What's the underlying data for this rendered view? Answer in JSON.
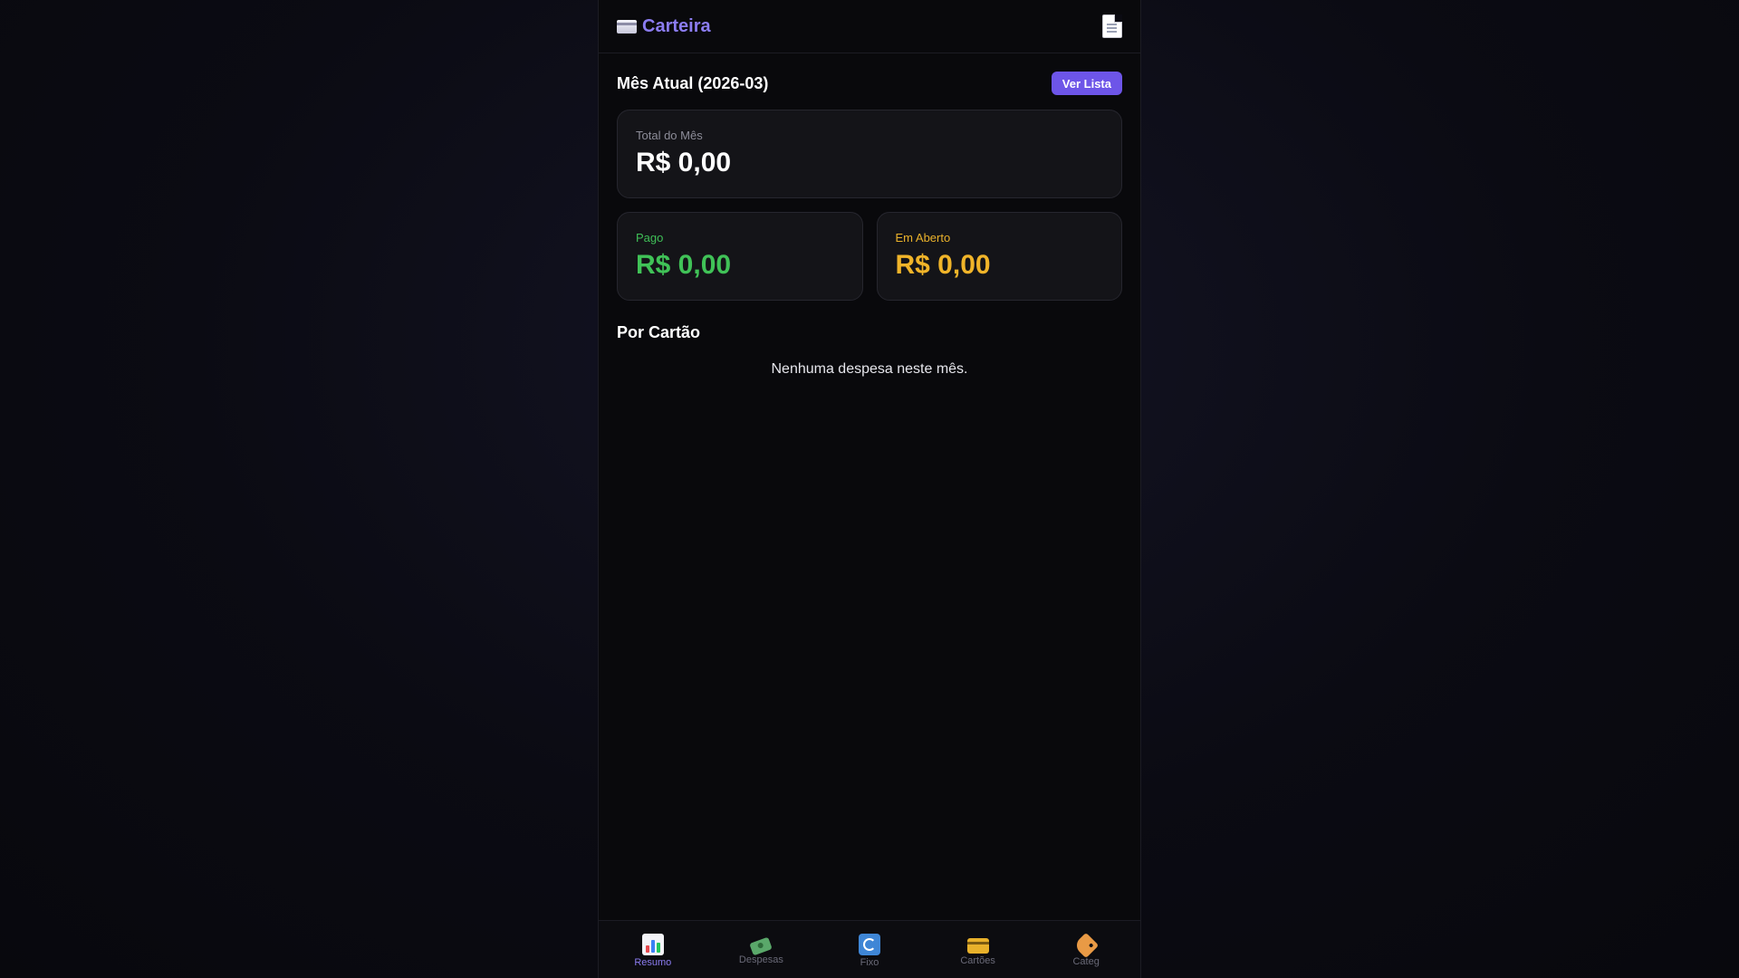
{
  "header": {
    "title": "Carteira",
    "brand_icon": "card-icon",
    "action_icon": "document-icon"
  },
  "summary": {
    "month_title": "Mês Atual (2026-03)",
    "view_list_label": "Ver Lista",
    "total": {
      "label": "Total do Mês",
      "value": "R$ 0,00"
    },
    "paid": {
      "label": "Pago",
      "value": "R$ 0,00",
      "color": "#40c257"
    },
    "open": {
      "label": "Em Aberto",
      "value": "R$ 0,00",
      "color": "#f0b429"
    }
  },
  "by_card": {
    "title": "Por Cartão",
    "empty_message": "Nenhuma despesa neste mês."
  },
  "nav": {
    "active": "Resumo",
    "accent": "#8b7cf0",
    "items": [
      {
        "label": "Resumo",
        "icon": "bar-chart-icon"
      },
      {
        "label": "Despesas",
        "icon": "money-wings-icon"
      },
      {
        "label": "Fixo",
        "icon": "repeat-icon"
      },
      {
        "label": "Cartões",
        "icon": "credit-card-icon"
      },
      {
        "label": "Categ",
        "icon": "tag-icon"
      }
    ]
  }
}
